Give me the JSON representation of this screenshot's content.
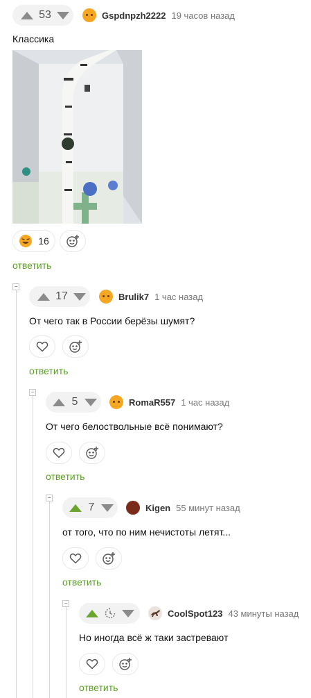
{
  "comments": [
    {
      "votes": "53",
      "user": "Gspdnpzh2222",
      "time": "19 часов назад",
      "text": "Классика",
      "reaction_count": "16",
      "reply": "ответить"
    },
    {
      "votes": "17",
      "user": "Brulik7",
      "time": "1 час назад",
      "text": "От чего так в России берёзы шумят?",
      "reply": "ответить"
    },
    {
      "votes": "5",
      "user": "RomaR557",
      "time": "1 час назад",
      "text": "От чего белоствольные всё понимают?",
      "reply": "ответить"
    },
    {
      "votes": "7",
      "user": "Kigen",
      "time": "55 минут назад",
      "text": "от того, что по ним нечистоты летят...",
      "reply": "ответить"
    },
    {
      "votes": "",
      "user": "CoolSpot123",
      "time": "43 минуты назад",
      "text": "Но иногда всё ж таки застревают",
      "reply": "ответить"
    }
  ],
  "colors": {
    "accent": "#5a9f25",
    "upvote_active": "#6ba530",
    "neutral": "#8b8b8b"
  }
}
